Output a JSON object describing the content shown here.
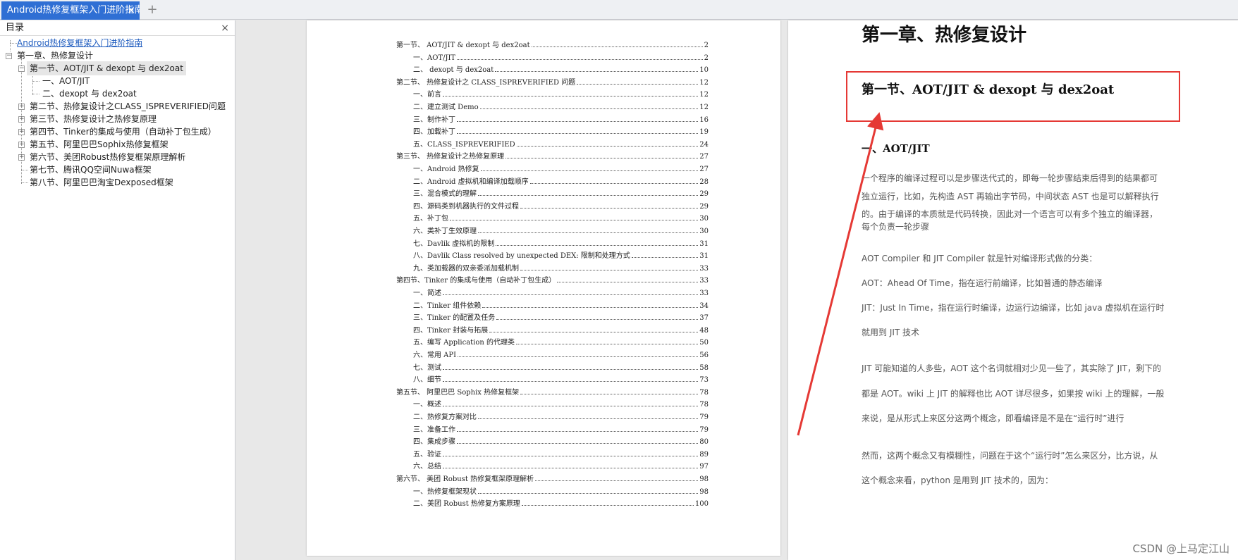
{
  "tab": {
    "title": "Android热修复框架入门进阶指南",
    "close": "×",
    "new": "+"
  },
  "sidebar": {
    "title": "目录",
    "close": "×",
    "items": [
      {
        "label": "Android热修复框架入门进阶指南"
      },
      {
        "label": "第一章、热修复设计"
      },
      {
        "label": "第一节、AOT/JIT & dexopt 与 dex2oat"
      },
      {
        "label": "一、AOT/JIT"
      },
      {
        "label": "二、dexopt 与 dex2oat"
      },
      {
        "label": "第二节、热修复设计之CLASS_ISPREVERIFIED问题"
      },
      {
        "label": "第三节、热修复设计之热修复原理"
      },
      {
        "label": "第四节、Tinker的集成与使用（自动补丁包生成）"
      },
      {
        "label": "第五节、阿里巴巴Sophix热修复框架"
      },
      {
        "label": "第六节、美团Robust热修复框架原理解析"
      },
      {
        "label": "第七节、腾讯QQ空间Nuwa框架"
      },
      {
        "label": "第八节、阿里巴巴淘宝Dexposed框架"
      }
    ]
  },
  "left_page": {
    "toc": [
      {
        "text": "第一节、  AOT/JIT & dexopt  与  dex2oat",
        "page": "2",
        "level": 1
      },
      {
        "text": "一、AOT/JIT",
        "page": "2",
        "level": 2
      },
      {
        "text": "二、  dexopt  与  dex2oat",
        "page": "10",
        "level": 2
      },
      {
        "text": "第二节、  热修复设计之 CLASS_ISPREVERIFIED 问题",
        "page": "12",
        "level": 1
      },
      {
        "text": "一、前言",
        "page": "12",
        "level": 2
      },
      {
        "text": "二、建立测试 Demo",
        "page": "12",
        "level": 2
      },
      {
        "text": "三、制作补丁",
        "page": "16",
        "level": 2
      },
      {
        "text": "四、加载补丁",
        "page": "19",
        "level": 2
      },
      {
        "text": "五、CLASS_ISPREVERIFIED",
        "page": "24",
        "level": 2
      },
      {
        "text": "第三节、  热修复设计之热修复原理",
        "page": "27",
        "level": 1
      },
      {
        "text": "一、Android  热修复",
        "page": "27",
        "level": 2
      },
      {
        "text": "二、Android  虚拟机和编译加载顺序",
        "page": "28",
        "level": 2
      },
      {
        "text": "三、混合模式的理解",
        "page": "29",
        "level": 2
      },
      {
        "text": "四、源码类到机器执行的文件过程",
        "page": "29",
        "level": 2
      },
      {
        "text": "五、补丁包",
        "page": "30",
        "level": 2
      },
      {
        "text": "六、类补丁生效原理",
        "page": "30",
        "level": 2
      },
      {
        "text": "七、Davlik  虚拟机的限制",
        "page": "31",
        "level": 2
      },
      {
        "text": "八、Davlik Class resolved by unexpected DEX: 限制和处理方式",
        "page": "31",
        "level": 2
      },
      {
        "text": "九、类加载器的双亲委派加载机制",
        "page": "33",
        "level": 2
      },
      {
        "text": "第四节、Tinker 的集成与使用（自动补丁包生成）",
        "page": "33",
        "level": 1
      },
      {
        "text": "一、简述",
        "page": "33",
        "level": 2
      },
      {
        "text": "二、Tinker 组件依赖",
        "page": "34",
        "level": 2
      },
      {
        "text": "三、Tinker 的配置及任务",
        "page": "37",
        "level": 2
      },
      {
        "text": "四、Tinker 封装与拓展",
        "page": "48",
        "level": 2
      },
      {
        "text": "五、编写 Application 的代理类",
        "page": "50",
        "level": 2
      },
      {
        "text": "六、常用 API",
        "page": "56",
        "level": 2
      },
      {
        "text": "七、测试",
        "page": "58",
        "level": 2
      },
      {
        "text": "八、细节",
        "page": "73",
        "level": 2
      },
      {
        "text": "第五节、  阿里巴巴 Sophix 热修复框架",
        "page": "78",
        "level": 1
      },
      {
        "text": "一、概述",
        "page": "78",
        "level": 2
      },
      {
        "text": "二、热修复方案对比",
        "page": "79",
        "level": 2
      },
      {
        "text": "三、准备工作",
        "page": "79",
        "level": 2
      },
      {
        "text": "四、集成步骤",
        "page": "80",
        "level": 2
      },
      {
        "text": "五、验证",
        "page": "89",
        "level": 2
      },
      {
        "text": "六、总结",
        "page": "97",
        "level": 2
      },
      {
        "text": "第六节、  美团 Robust 热修复框架原理解析",
        "page": "98",
        "level": 1
      },
      {
        "text": "一、热修复框架现状",
        "page": "98",
        "level": 2
      },
      {
        "text": "二、美团  Robust  热修复方案原理",
        "page": "100",
        "level": 2
      }
    ]
  },
  "right_page": {
    "chapter_title": "第一章、热修复设计",
    "section_title": "第一节、AOT/JIT & dexopt 与 dex2oat",
    "subsection_title": "一、AOT/JIT",
    "paragraphs": [
      "一个程序的编译过程可以是步骤迭代式的，即每一轮步骤结束后得到的结果都可",
      "独立运行，比如，先构造 AST 再输出字节码，中间状态 AST 也是可以解释执行",
      "的。由于编译的本质就是代码转换，因此对一个语言可以有多个独立的编译器，",
      "每个负责一轮步骤",
      "AOT Compiler 和 JIT Compiler 就是针对编译形式做的分类：",
      "AOT：Ahead Of Time，指在运行前编译，比如普通的静态编译",
      "JIT：Just In Time，指在运行时编译，边运行边编译，比如 java 虚拟机在运行时",
      "就用到 JIT 技术",
      "JIT 可能知道的人多些，AOT 这个名词就相对少见一些了，其实除了 JIT，剩下的",
      "都是 AOT。wiki 上 JIT 的解释也比 AOT 详尽很多，如果按 wiki 上的理解，一般",
      "来说，是从形式上来区分这两个概念，即看编译是不是在“运行时”进行",
      "然而，这两个概念又有模糊性，问题在于这个“运行时”怎么来区分，比方说，从",
      "这个概念来看，python 是用到 JIT 技术的，因为："
    ]
  },
  "watermark": "CSDN @上马定江山",
  "colors": {
    "tab_active": "#2f6fd4",
    "annotation_red": "#e53935",
    "link": "#1f5cbf"
  }
}
